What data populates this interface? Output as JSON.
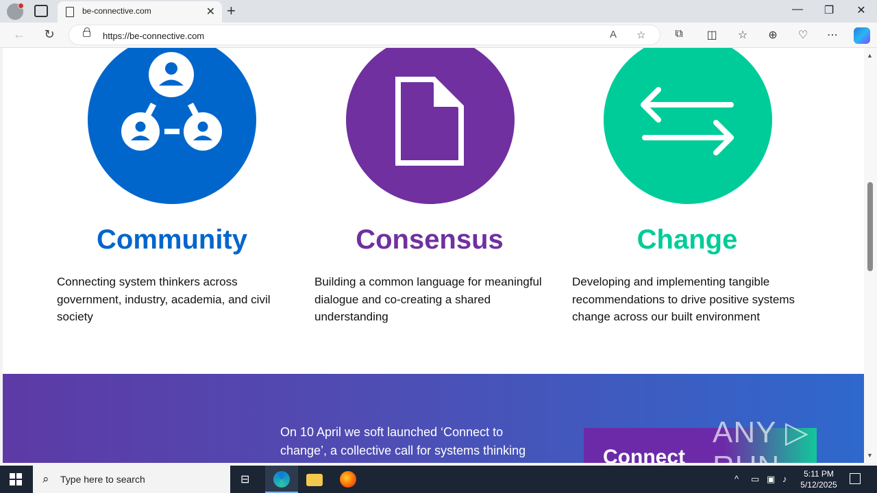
{
  "browser": {
    "tab_title": "be-connective.com",
    "url": "https://be-connective.com",
    "new_tab_label": "+",
    "tab_close": "✕"
  },
  "features": [
    {
      "title": "Community",
      "color": "#0066cc",
      "icon": "community-network-icon",
      "description": "Connecting system thinkers across government, industry, academia, and civil society"
    },
    {
      "title": "Consensus",
      "color": "#7030a0",
      "icon": "document-icon",
      "description": "Building a common language for meaningful dialogue and co-creating a shared understanding"
    },
    {
      "title": "Change",
      "color": "#00cc99",
      "icon": "exchange-arrows-icon",
      "description": "Developing and implementing tangible recommendations to drive positive systems change across our built environment"
    }
  ],
  "banner": {
    "text": "On 10 April we soft launched ‘Connect to change’, a collective call for systems thinking",
    "card_title": "Connect"
  },
  "watermark": "ANY ▷ RUN",
  "taskbar": {
    "search_placeholder": "Type here to search",
    "time": "5:11 PM",
    "date": "5/12/2025"
  }
}
